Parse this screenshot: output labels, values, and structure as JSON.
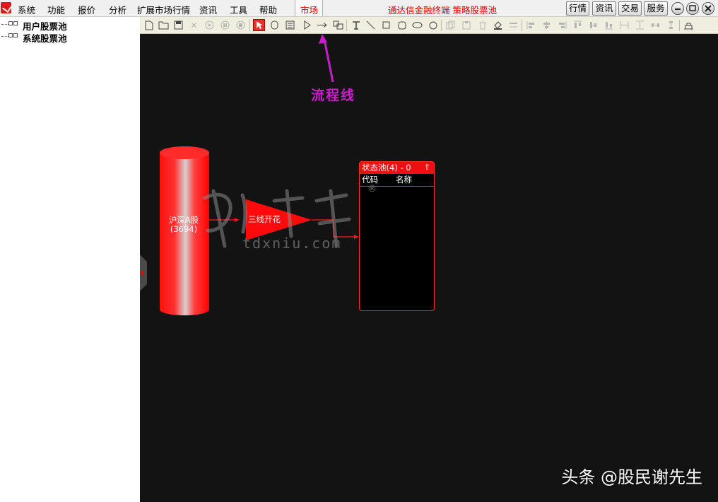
{
  "menu": {
    "items": [
      "系统",
      "功能",
      "报价",
      "分析",
      "扩展市场行情",
      "资讯",
      "工具",
      "帮助"
    ],
    "market_tab": "市场",
    "title": "通达信金融终端  策略股票池",
    "right_buttons": [
      "行情",
      "资讯",
      "交易",
      "服务"
    ]
  },
  "window_controls": [
    "minimize-icon",
    "restore-icon",
    "close-icon"
  ],
  "tree": {
    "items": [
      "用户股票池",
      "系统股票池"
    ]
  },
  "toolbar": {
    "icons": [
      "new-file-icon",
      "open-folder-icon",
      "save-icon",
      "delete-icon",
      "play-icon",
      "pause-icon",
      "stop-icon",
      "select-pointer-icon",
      "cylinder-data-icon",
      "table-node-icon",
      "triangle-filter-icon",
      "flow-line-arrow-icon",
      "composite-node-icon",
      "text-tool-icon",
      "line-tool-icon",
      "rectangle-tool-icon",
      "rounded-rect-tool-icon",
      "ellipse-tool-icon",
      "circle-tool-icon",
      "copy-icon",
      "paste-icon",
      "trash-icon",
      "fill-color-icon",
      "line-style-icon",
      "align-left-icon",
      "align-center-icon",
      "align-right-icon",
      "align-top-icon",
      "align-middle-icon",
      "align-bottom-icon",
      "same-width-icon",
      "same-height-icon",
      "space-horizontal-icon",
      "space-vertical-icon",
      "properties-icon"
    ]
  },
  "canvas": {
    "annotation": "流程线",
    "source_node": {
      "name": "沪深A股",
      "count": "(3694)"
    },
    "filter_node": {
      "label": "三线开花"
    },
    "pool_node": {
      "title": "状态池(4) - 0",
      "columns": [
        "代码",
        "名称"
      ]
    },
    "watermark": {
      "domain": "tdxniu.com",
      "reg": "®"
    },
    "credit": "头条 @股民谢先生"
  },
  "colors": {
    "node_red": "#ee1010",
    "annotation_purple": "#c81ec8",
    "canvas_bg": "#131313",
    "toolbar_bg": "#f0eedf"
  }
}
